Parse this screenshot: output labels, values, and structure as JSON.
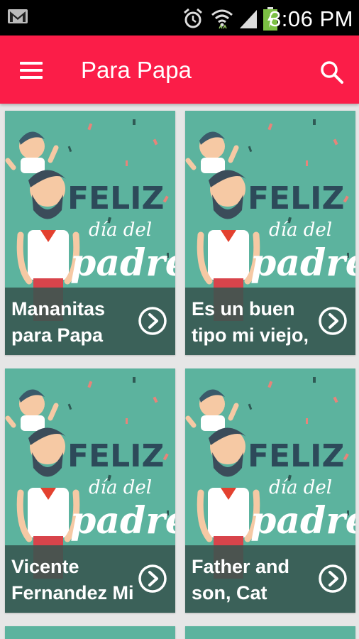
{
  "status_bar": {
    "time": "3:06 PM",
    "icons": [
      "gmail-icon",
      "alarm-icon",
      "wifi-icon",
      "signal-icon",
      "battery-icon"
    ]
  },
  "app_bar": {
    "title": "Para Papa",
    "menu_icon": "hamburger-menu-icon",
    "search_icon": "search-icon",
    "color": "#fb1d48"
  },
  "cards": [
    {
      "art_line1": "FELIZ",
      "art_line2": "día del",
      "art_line3": "padre",
      "title": "Mananitas\npara Papa"
    },
    {
      "art_line1": "FELIZ",
      "art_line2": "día del",
      "art_line3": "padre",
      "title": "Es un buen\ntipo mi viejo,"
    },
    {
      "art_line1": "FELIZ",
      "art_line2": "día del",
      "art_line3": "padre",
      "title": "Vicente\nFernandez Mi"
    },
    {
      "art_line1": "FELIZ",
      "art_line2": "día del",
      "art_line3": "padre",
      "title": "Father and\nson, Cat"
    }
  ],
  "colors": {
    "card_bg": "#5cb39e",
    "caption_bg": "#375550",
    "page_bg": "#e6e6e6"
  }
}
